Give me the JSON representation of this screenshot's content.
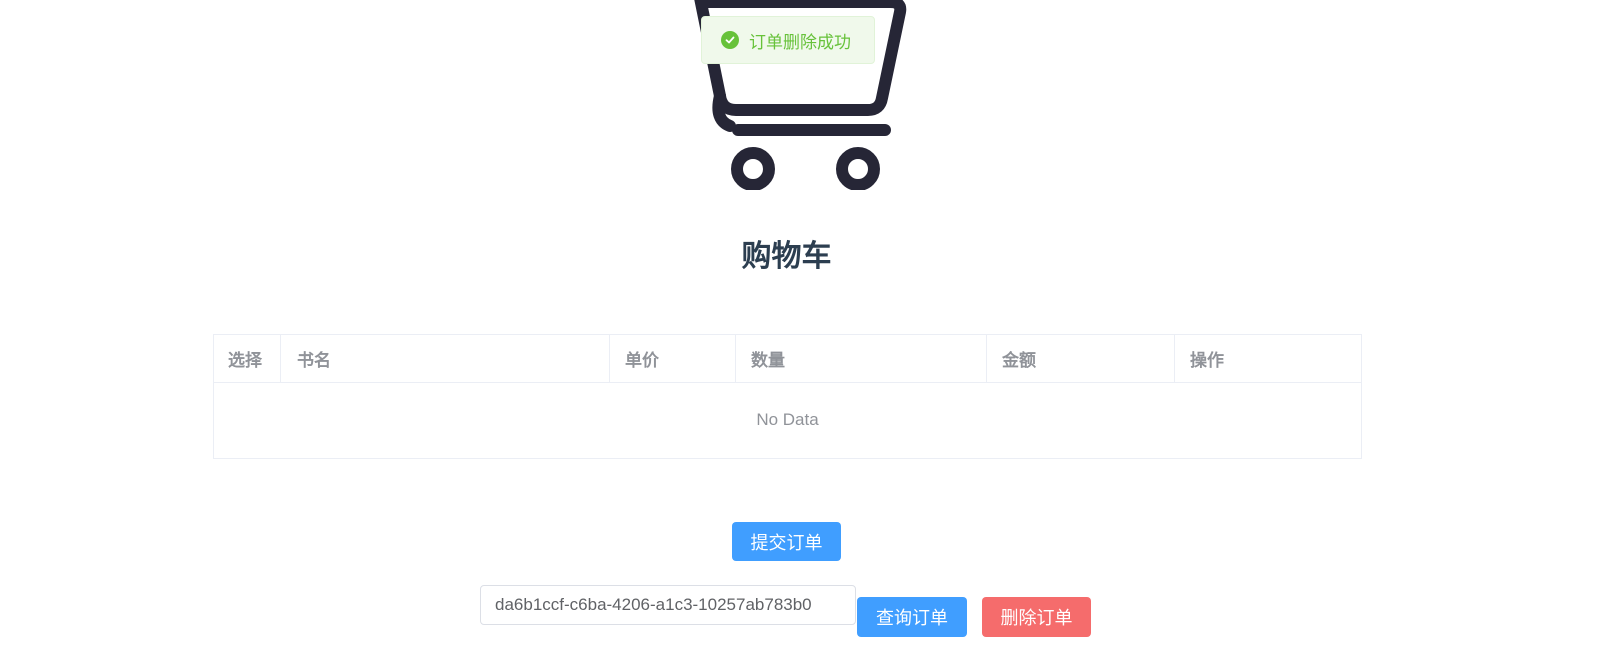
{
  "toast": {
    "message": "订单删除成功",
    "icon": "check-circle-icon",
    "color": "#67c23a"
  },
  "header": {
    "icon": "shopping-cart-icon",
    "title": "购物车"
  },
  "table": {
    "columns": [
      "选择",
      "书名",
      "单价",
      "数量",
      "金额",
      "操作"
    ],
    "rows": [],
    "empty_text": "No Data"
  },
  "actions": {
    "submit_label": "提交订单",
    "order_id_value": "da6b1ccf-c6ba-4206-a1c3-10257ab783b0",
    "query_label": "查询订单",
    "delete_label": "删除订单"
  },
  "colors": {
    "primary": "#409eff",
    "danger": "#f56c6c",
    "icon_stroke": "#262636"
  }
}
